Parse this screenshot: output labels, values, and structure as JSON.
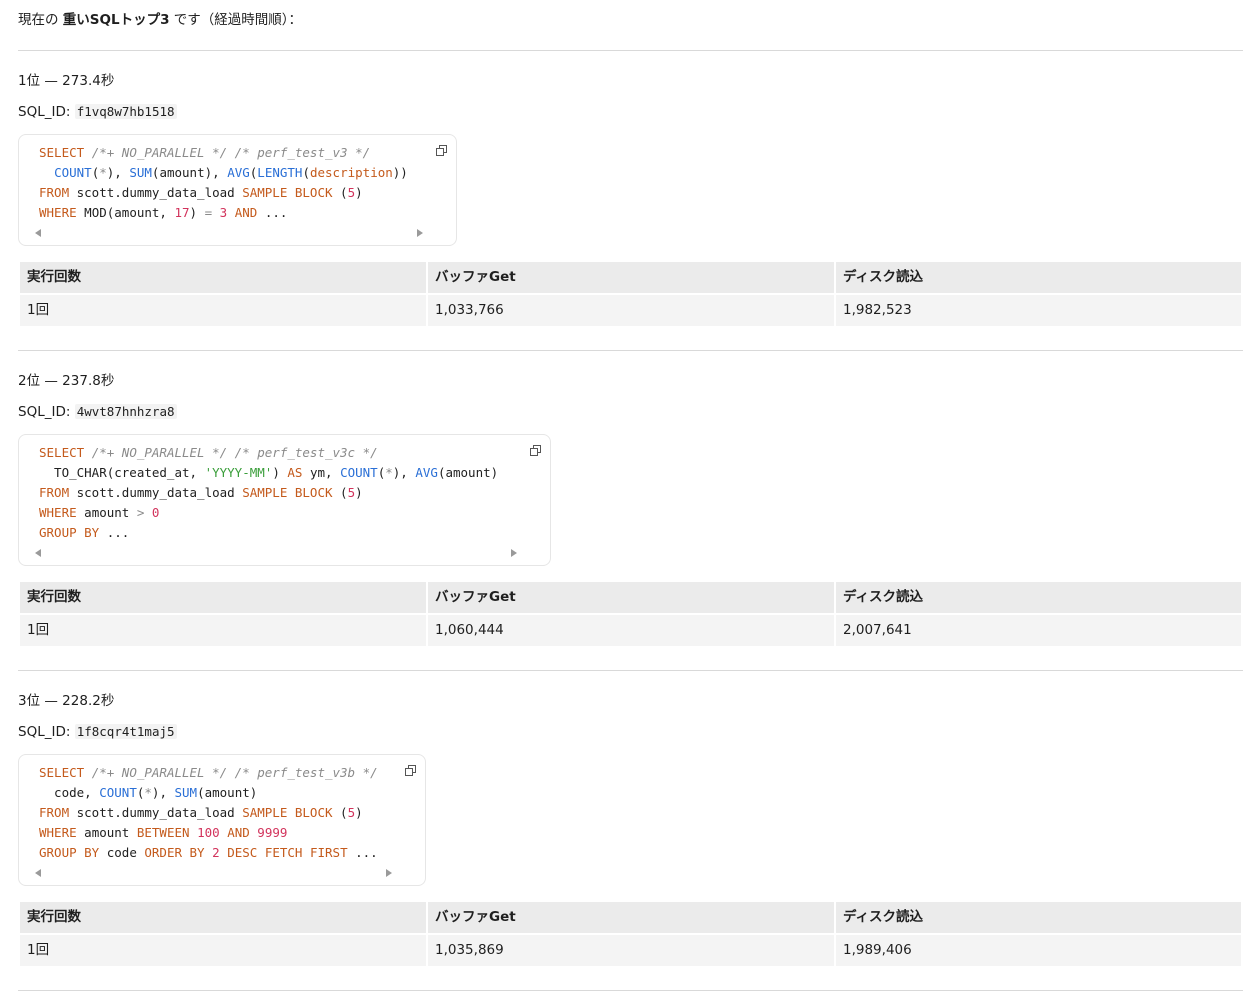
{
  "intro": {
    "prefix": "現在の ",
    "bold": "重いSQLトップ3",
    "suffix": " です（経過時間順）："
  },
  "table_headers": [
    "実行回数",
    "バッファGet",
    "ディスク読込"
  ],
  "sql_id_label": "SQL_ID: ",
  "entries": [
    {
      "rank": "1位 — 273.4秒",
      "sql_id": "f1vq8w7hb1518",
      "code": [
        [
          [
            "kw",
            "SELECT"
          ],
          [
            "t",
            " "
          ],
          [
            "cm",
            "/*+ NO_PARALLEL */ /* perf_test_v3 */"
          ]
        ],
        [
          [
            "t",
            "  "
          ],
          [
            "fn",
            "COUNT"
          ],
          [
            "t",
            "("
          ],
          [
            "op",
            "*"
          ],
          [
            "t",
            "), "
          ],
          [
            "fn",
            "SUM"
          ],
          [
            "t",
            "(amount), "
          ],
          [
            "fn",
            "AVG"
          ],
          [
            "t",
            "("
          ],
          [
            "fn",
            "LENGTH"
          ],
          [
            "t",
            "("
          ],
          [
            "kw",
            "description"
          ],
          [
            "t",
            "))"
          ]
        ],
        [
          [
            "kw",
            "FROM"
          ],
          [
            "t",
            " scott.dummy_data_load "
          ],
          [
            "kw",
            "SAMPLE BLOCK"
          ],
          [
            "t",
            " ("
          ],
          [
            "num",
            "5"
          ],
          [
            "t",
            ")"
          ]
        ],
        [
          [
            "kw",
            "WHERE"
          ],
          [
            "t",
            " MOD(amount, "
          ],
          [
            "num",
            "17"
          ],
          [
            "t",
            ") "
          ],
          [
            "op",
            "="
          ],
          [
            "t",
            " "
          ],
          [
            "num",
            "3"
          ],
          [
            "t",
            " "
          ],
          [
            "kw",
            "AND"
          ],
          [
            "t",
            " ..."
          ]
        ]
      ],
      "stats": {
        "executions": "1回",
        "buffer_gets": "1,033,766",
        "disk_reads": "1,982,523"
      }
    },
    {
      "rank": "2位 — 237.8秒",
      "sql_id": "4wvt87hnhzra8",
      "code": [
        [
          [
            "kw",
            "SELECT"
          ],
          [
            "t",
            " "
          ],
          [
            "cm",
            "/*+ NO_PARALLEL */ /* perf_test_v3c */"
          ]
        ],
        [
          [
            "t",
            "  TO_CHAR(created_at, "
          ],
          [
            "str",
            "'YYYY-MM'"
          ],
          [
            "t",
            ") "
          ],
          [
            "kw",
            "AS"
          ],
          [
            "t",
            " ym, "
          ],
          [
            "fn",
            "COUNT"
          ],
          [
            "t",
            "("
          ],
          [
            "op",
            "*"
          ],
          [
            "t",
            "), "
          ],
          [
            "fn",
            "AVG"
          ],
          [
            "t",
            "(amount)"
          ]
        ],
        [
          [
            "kw",
            "FROM"
          ],
          [
            "t",
            " scott.dummy_data_load "
          ],
          [
            "kw",
            "SAMPLE BLOCK"
          ],
          [
            "t",
            " ("
          ],
          [
            "num",
            "5"
          ],
          [
            "t",
            ")"
          ]
        ],
        [
          [
            "kw",
            "WHERE"
          ],
          [
            "t",
            " amount "
          ],
          [
            "op",
            ">"
          ],
          [
            "t",
            " "
          ],
          [
            "num",
            "0"
          ]
        ],
        [
          [
            "kw",
            "GROUP BY"
          ],
          [
            "t",
            " ..."
          ]
        ]
      ],
      "stats": {
        "executions": "1回",
        "buffer_gets": "1,060,444",
        "disk_reads": "2,007,641"
      }
    },
    {
      "rank": "3位 — 228.2秒",
      "sql_id": "1f8cqr4t1maj5",
      "code": [
        [
          [
            "kw",
            "SELECT"
          ],
          [
            "t",
            " "
          ],
          [
            "cm",
            "/*+ NO_PARALLEL */ /* perf_test_v3b */"
          ]
        ],
        [
          [
            "t",
            "  code, "
          ],
          [
            "fn",
            "COUNT"
          ],
          [
            "t",
            "("
          ],
          [
            "op",
            "*"
          ],
          [
            "t",
            "), "
          ],
          [
            "fn",
            "SUM"
          ],
          [
            "t",
            "(amount)"
          ]
        ],
        [
          [
            "kw",
            "FROM"
          ],
          [
            "t",
            " scott.dummy_data_load "
          ],
          [
            "kw",
            "SAMPLE BLOCK"
          ],
          [
            "t",
            " ("
          ],
          [
            "num",
            "5"
          ],
          [
            "t",
            ")"
          ]
        ],
        [
          [
            "kw",
            "WHERE"
          ],
          [
            "t",
            " amount "
          ],
          [
            "kw",
            "BETWEEN"
          ],
          [
            "t",
            " "
          ],
          [
            "num",
            "100"
          ],
          [
            "t",
            " "
          ],
          [
            "kw",
            "AND"
          ],
          [
            "t",
            " "
          ],
          [
            "num",
            "9999"
          ]
        ],
        [
          [
            "kw",
            "GROUP BY"
          ],
          [
            "t",
            " code "
          ],
          [
            "kw",
            "ORDER BY"
          ],
          [
            "t",
            " "
          ],
          [
            "num",
            "2"
          ],
          [
            "t",
            " "
          ],
          [
            "kw",
            "DESC FETCH FIRST"
          ],
          [
            "t",
            " ..."
          ]
        ]
      ],
      "stats": {
        "executions": "1回",
        "buffer_gets": "1,035,869",
        "disk_reads": "1,989,406"
      }
    }
  ]
}
